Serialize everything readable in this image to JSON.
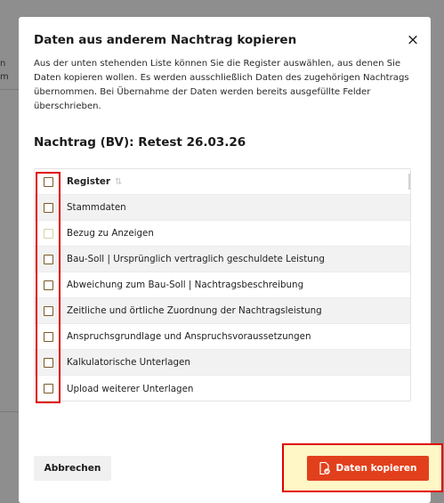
{
  "background": {
    "fragment_lines": [
      "n",
      "m"
    ]
  },
  "modal": {
    "title": "Daten aus anderem Nachtrag kopieren",
    "close_icon": "×",
    "description": "Aus der unten stehenden Liste können Sie die Register auswählen, aus denen Sie Daten kopieren wollen. Es werden ausschließlich Daten des zugehörigen Nachtrags übernommen. Bei Übernahme der Daten werden bereits ausgefüllte Felder überschrieben.",
    "subtitle": "Nachtrag (BV): Retest 26.03.26",
    "table": {
      "header": "Register",
      "sort_icon": "⇅",
      "rows": [
        "Stammdaten",
        "Bezug zu Anzeigen",
        "Bau-Soll | Ursprünglich vertraglich geschuldete Leistung",
        "Abweichung zum Bau-Soll | Nachtragsbeschreibung",
        "Zeitliche und örtliche Zuordnung der Nachtragsleistung",
        "Anspruchsgrundlage und Anspruchsvoraussetzungen",
        "Kalkulatorische Unterlagen",
        "Upload weiterer Unterlagen"
      ]
    },
    "cancel_label": "Abbrechen",
    "copy_label": "Daten kopieren",
    "copy_icon": "document-check-icon"
  },
  "colors": {
    "accent": "#e2401c",
    "highlight": "#e00000"
  }
}
